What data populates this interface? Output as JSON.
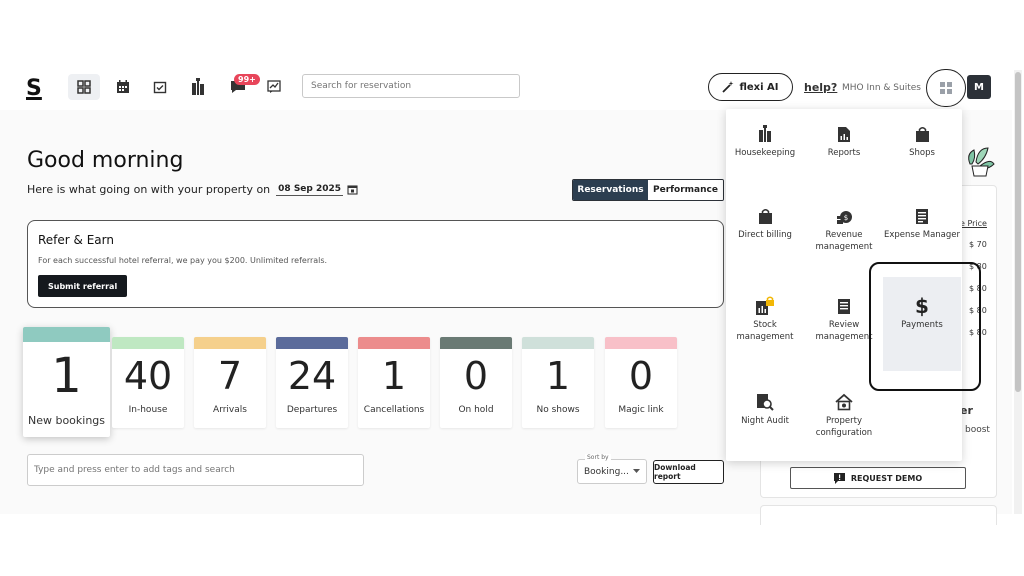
{
  "header": {
    "logo": "S",
    "notification_badge": "99+",
    "search_placeholder": "Search for reservation",
    "flexi_label": "flexi AI",
    "help_label": "help?",
    "property_name": "MHO Inn & Suites",
    "avatar_initial": "M"
  },
  "main": {
    "greeting": "Good morning",
    "subtitle": "Here is what going on with your property on",
    "date": "08 Sep 2025",
    "toggle": {
      "reservations": "Reservations",
      "performance": "Performance"
    },
    "refer": {
      "title": "Refer & Earn",
      "text": "For each successful hotel referral, we pay you $200. Unlimited referrals.",
      "button": "Submit referral"
    },
    "stats": [
      {
        "value": "1",
        "label": "New bookings",
        "color": "#8fcac0"
      },
      {
        "value": "40",
        "label": "In-house",
        "color": "#bfe8c2"
      },
      {
        "value": "7",
        "label": "Arrivals",
        "color": "#f5d08c"
      },
      {
        "value": "24",
        "label": "Departures",
        "color": "#5b6b9b"
      },
      {
        "value": "1",
        "label": "Cancellations",
        "color": "#ec8c8c"
      },
      {
        "value": "0",
        "label": "On hold",
        "color": "#6a7a74"
      },
      {
        "value": "1",
        "label": "No shows",
        "color": "#cfe0da"
      },
      {
        "value": "0",
        "label": "Magic link",
        "color": "#f8c0c8"
      }
    ],
    "tags_placeholder": "Type and press enter to add tags and search",
    "sort_label": "Sort by",
    "sort_value": "Booking...",
    "download_label": "Download report"
  },
  "right_panel": {
    "price_header": "e Price",
    "prices": [
      "$ 70",
      "$ 80",
      "$ 80",
      "$ 80",
      "$ 80"
    ],
    "snippet_letter": "er",
    "snippet_boost": "boost",
    "demo_label": "REQUEST DEMO"
  },
  "apps_menu": {
    "items": [
      {
        "label": "Housekeeping",
        "icon": "housekeeping-icon"
      },
      {
        "label": "Reports",
        "icon": "reports-icon"
      },
      {
        "label": "Shops",
        "icon": "shops-icon"
      },
      {
        "label": "Direct billing",
        "icon": "direct-billing-icon"
      },
      {
        "label": "Revenue management",
        "icon": "revenue-icon"
      },
      {
        "label": "Expense Manager",
        "icon": "expense-icon"
      },
      {
        "label": "Stock management",
        "icon": "stock-icon"
      },
      {
        "label": "Review management",
        "icon": "review-icon"
      },
      {
        "label": "Payments",
        "icon": "dollar-icon"
      },
      {
        "label": "Night Audit",
        "icon": "night-audit-icon"
      },
      {
        "label": "Property configuration",
        "icon": "property-icon"
      }
    ]
  },
  "colors": {
    "dark": "#2c3e50",
    "accent_red": "#e8455a",
    "badge_gold": "#f2b705"
  }
}
